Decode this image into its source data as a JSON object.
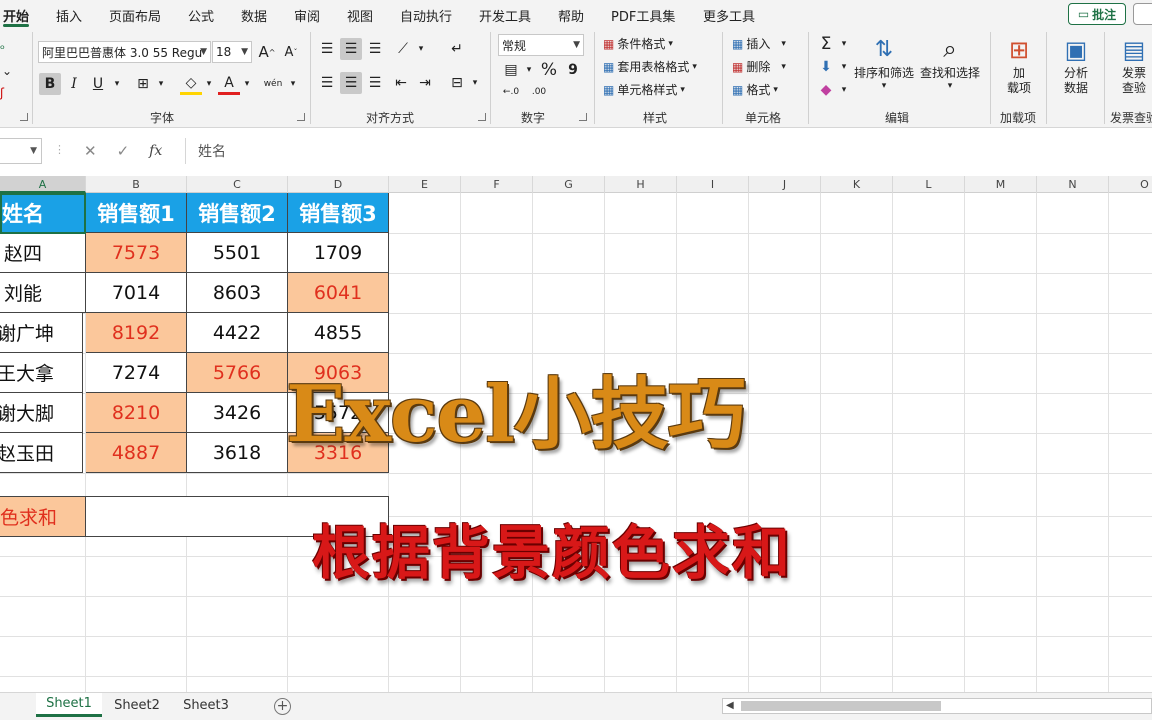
{
  "ribbon_tabs": [
    "开始",
    "插入",
    "页面布局",
    "公式",
    "数据",
    "审阅",
    "视图",
    "自动执行",
    "开发工具",
    "帮助",
    "PDF工具集",
    "更多工具"
  ],
  "comment_button": "批注",
  "font": {
    "name": "阿里巴巴普惠体 3.0 55 Regu",
    "size": "18",
    "grow": "A",
    "shrink": "A",
    "bold": "B",
    "italic": "I",
    "underline": "U",
    "font_color_glyph": "A",
    "phonetic_glyph": "wén",
    "group_label": "字体"
  },
  "alignment": {
    "group_label": "对齐方式"
  },
  "number": {
    "format": "常规",
    "percent": "%",
    "comma": "9",
    "group_label": "数字"
  },
  "styles": {
    "conditional_format": "条件格式",
    "table_format": "套用表格格式",
    "cell_styles": "单元格样式",
    "group_label": "样式"
  },
  "cells": {
    "insert": "插入",
    "delete": "删除",
    "format": "格式",
    "group_label": "单元格"
  },
  "editing": {
    "sort_filter": "排序和筛选",
    "find_select": "查找和选择",
    "group_label": "编辑"
  },
  "addins": {
    "label": "加\n载项",
    "group_label": "加载项"
  },
  "analyze": {
    "label": "分析\n数据"
  },
  "invoice": {
    "label": "发票\n查验",
    "group_label": "发票查验"
  },
  "formula_bar": {
    "fx": "fx",
    "value": "姓名"
  },
  "columns": [
    "A",
    "B",
    "C",
    "D",
    "E",
    "F",
    "G",
    "H",
    "I",
    "J",
    "K",
    "L",
    "M",
    "N",
    "O"
  ],
  "table": {
    "headers": [
      "姓名",
      "销售额1",
      "销售额2",
      "销售额3"
    ],
    "rows": [
      {
        "name": "赵四",
        "values": [
          "7573",
          "5501",
          "1709"
        ],
        "highlight": [
          true,
          false,
          false
        ]
      },
      {
        "name": "刘能",
        "values": [
          "7014",
          "8603",
          "6041"
        ],
        "highlight": [
          false,
          false,
          true
        ]
      },
      {
        "name": "谢广坤",
        "values": [
          "8192",
          "4422",
          "4855"
        ],
        "highlight": [
          true,
          false,
          false
        ]
      },
      {
        "name": "王大拿",
        "values": [
          "7274",
          "5766",
          "9063"
        ],
        "highlight": [
          false,
          true,
          true
        ]
      },
      {
        "name": "谢大脚",
        "values": [
          "8210",
          "3426",
          "5572"
        ],
        "highlight": [
          true,
          false,
          false
        ]
      },
      {
        "name": "赵玉田",
        "values": [
          "4887",
          "3618",
          "3316"
        ],
        "highlight": [
          true,
          false,
          true
        ]
      }
    ],
    "highlight_color": "#fbc79b",
    "highlight_text_color": "#e0301e",
    "header_color": "#1aa1e6"
  },
  "sum_label": "颜色求和",
  "overlay": {
    "title": "Excel小技巧",
    "subtitle": "根据背景颜色求和"
  },
  "sheets": [
    "Sheet1",
    "Sheet2",
    "Sheet3"
  ]
}
